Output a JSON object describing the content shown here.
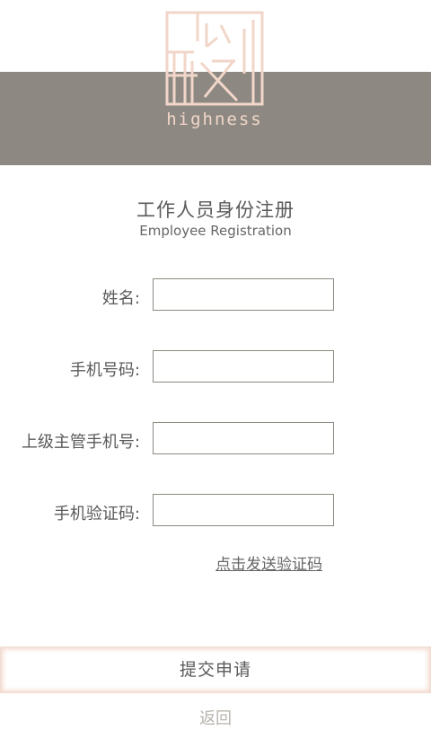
{
  "brand": {
    "wordmark": "highness",
    "logo_icon": "highness-calligraphy-logo",
    "logo_color": "#f1d6c9",
    "banner_color": "#8d8982"
  },
  "heading": {
    "title_cn": "工作人员身份注册",
    "title_en": "Employee Registration"
  },
  "form": {
    "fields": [
      {
        "label": "姓名:",
        "value": ""
      },
      {
        "label": "手机号码:",
        "value": ""
      },
      {
        "label": "上级主管手机号:",
        "value": ""
      },
      {
        "label": "手机验证码:",
        "value": ""
      }
    ],
    "send_code_label": "点击发送验证码"
  },
  "actions": {
    "submit_label": "提交申请",
    "back_label": "返回"
  }
}
